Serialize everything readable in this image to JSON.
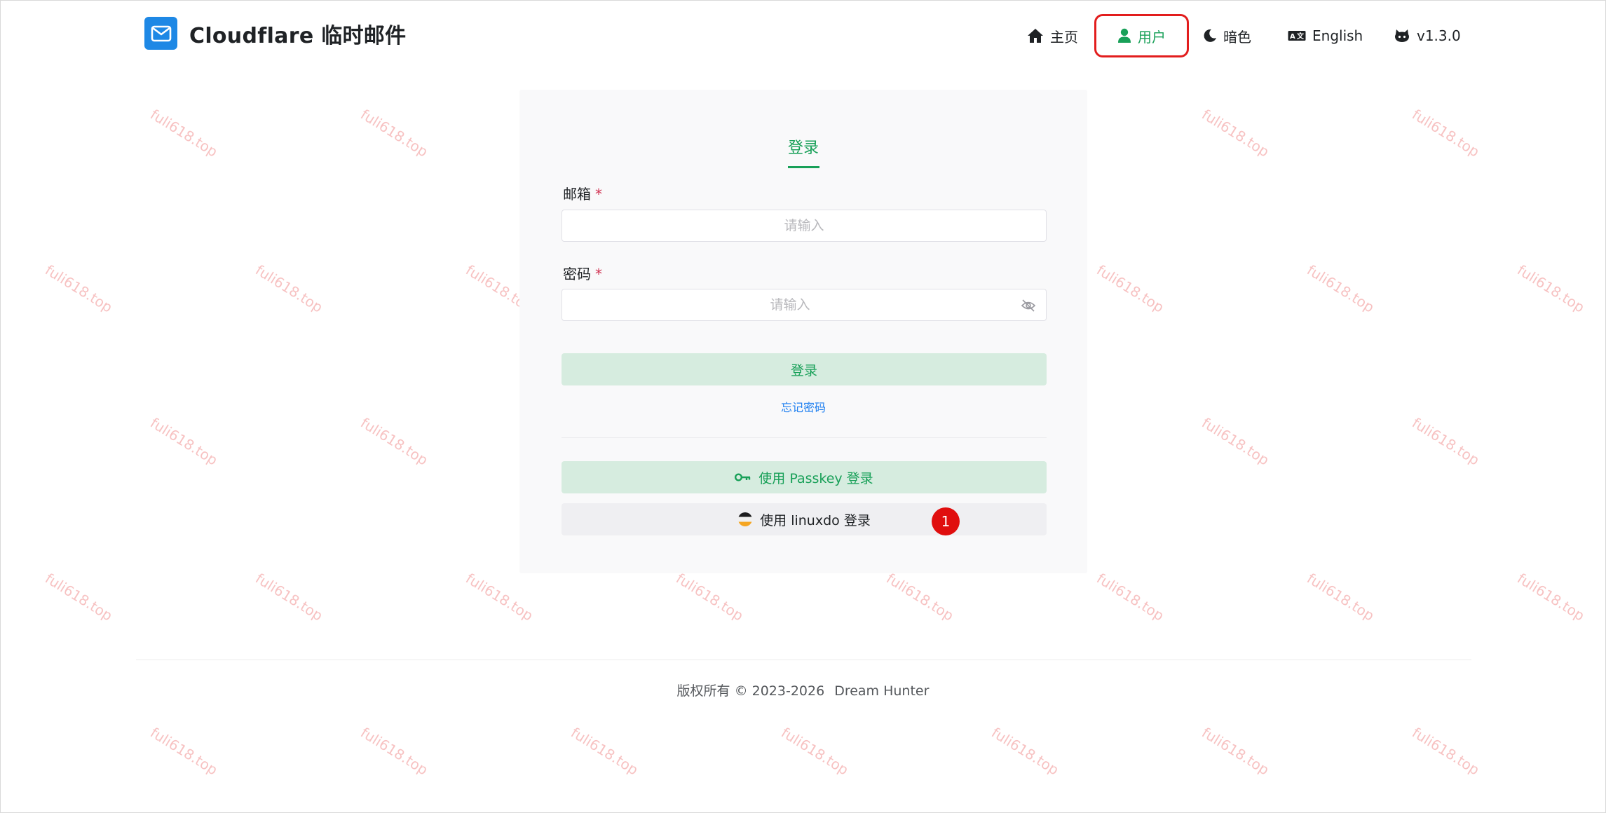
{
  "header": {
    "title": "Cloudflare 临时邮件",
    "nav": {
      "home": "主页",
      "user": "用户",
      "dark": "暗色",
      "language": "English",
      "version": "v1.3.0"
    }
  },
  "login": {
    "tab": "登录",
    "email_label": "邮箱",
    "email_placeholder": "请输入",
    "password_label": "密码",
    "password_placeholder": "请输入",
    "required_mark": "*",
    "login_button": "登录",
    "forgot_password": "忘记密码",
    "passkey_button": "使用 Passkey 登录",
    "linuxdo_button": "使用 linuxdo 登录",
    "annotation_badge": "1"
  },
  "footer": {
    "copyright": "版权所有 © 2023-2026",
    "owner": "Dream Hunter"
  },
  "watermark": {
    "text": "fuli618.top"
  },
  "colors": {
    "primary": "#18a058",
    "brand_logo": "#1e88e5",
    "highlight_border": "#e21d1d",
    "link": "#2080f0",
    "badge": "#e00e0e"
  }
}
